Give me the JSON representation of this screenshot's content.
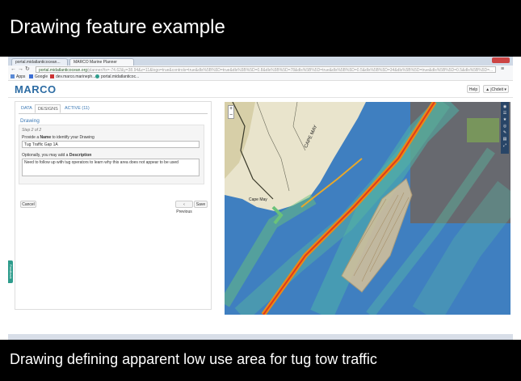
{
  "slide": {
    "title": "Drawing feature example",
    "caption": "Drawing defining apparent low use area for tug tow traffic"
  },
  "browser": {
    "tabs": [
      {
        "label": "portal.midatlanticocean..."
      },
      {
        "label": "MARCO Marine Planner"
      }
    ],
    "url_host": "portal.midatlanticocean.org",
    "url_path": "/planner/#x=-74.62&y=38.94&z=11&logo=true&controls=true&dls%5B%5D=true&dls%5B%5D=0.8&dls%5B%5D=78&dls%5B%5D=true&dls%5B%5D=0.5&dls%5B%5D=34&dls%5B%5D=true&dls%5B%5D=0.5&dls%5B%5D=...",
    "bookmarks": [
      "Apps",
      "Google",
      "dev.marco.marineph...",
      "portal.midatlanticoc..."
    ]
  },
  "app": {
    "logo": "MARCO",
    "help_label": "Help",
    "user_label": "▲ jChdeit ▾"
  },
  "panel": {
    "tabs": [
      {
        "label": "DATA"
      },
      {
        "label": "DESIGNS"
      },
      {
        "label": "ACTIVE (11)"
      }
    ],
    "section_title": "Drawing",
    "step": "Step 2 of 2",
    "name_prefix": "Provide a",
    "name_bold": "Name",
    "name_suffix": "to identify your Drawing",
    "name_value": "Tug Traffic Gap 1A",
    "desc_prefix": "Optionally, you may add a",
    "desc_bold": "Description",
    "desc_value": "Need to follow up with tug operators to learn why this area does not appear to be used",
    "cancel_label": "Cancel",
    "previous_label": "‹ Previous",
    "save_label": "Save",
    "side_tab_label": "Feedback"
  },
  "map": {
    "zoom_in": "+",
    "zoom_out": "−",
    "place_labels": [
      "CAPE MAY",
      "Cape May"
    ]
  }
}
